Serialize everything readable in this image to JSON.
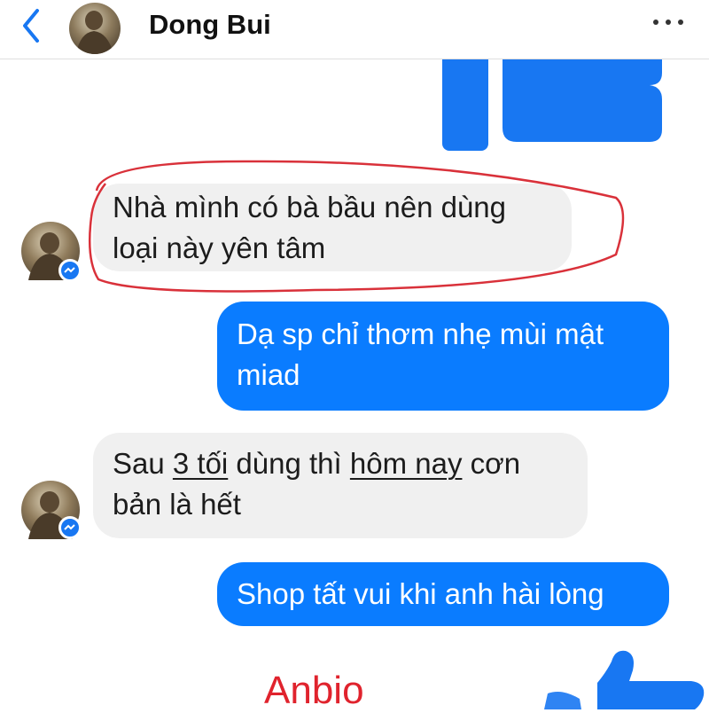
{
  "header": {
    "contact_name": "Dong Bui",
    "icons": {
      "back": "chevron-left-icon",
      "more": "more-dots-icon"
    }
  },
  "messages": [
    {
      "side": "incoming",
      "lines": [
        "Nhà mình có bà bầu nên dùng",
        "loại này yên tâm"
      ],
      "highlighted": true
    },
    {
      "side": "outgoing",
      "lines": [
        "Dạ sp chỉ thơm nhẹ mùi mật",
        "miad"
      ]
    },
    {
      "side": "incoming",
      "segments": {
        "a": "Sau ",
        "b": "3 tối",
        "c": " dùng thì ",
        "d": "hôm nay",
        "e": " cơn",
        "line2": "bản là hết"
      }
    },
    {
      "side": "outgoing",
      "lines": [
        "Shop tất vui khi anh hài lòng"
      ]
    }
  ],
  "watermark": "Anbio",
  "colors": {
    "outgoing_bubble": "#0a7cff",
    "incoming_bubble": "#f0f0f0",
    "accent": "#1877f2",
    "highlight_ring": "#d9313a"
  }
}
